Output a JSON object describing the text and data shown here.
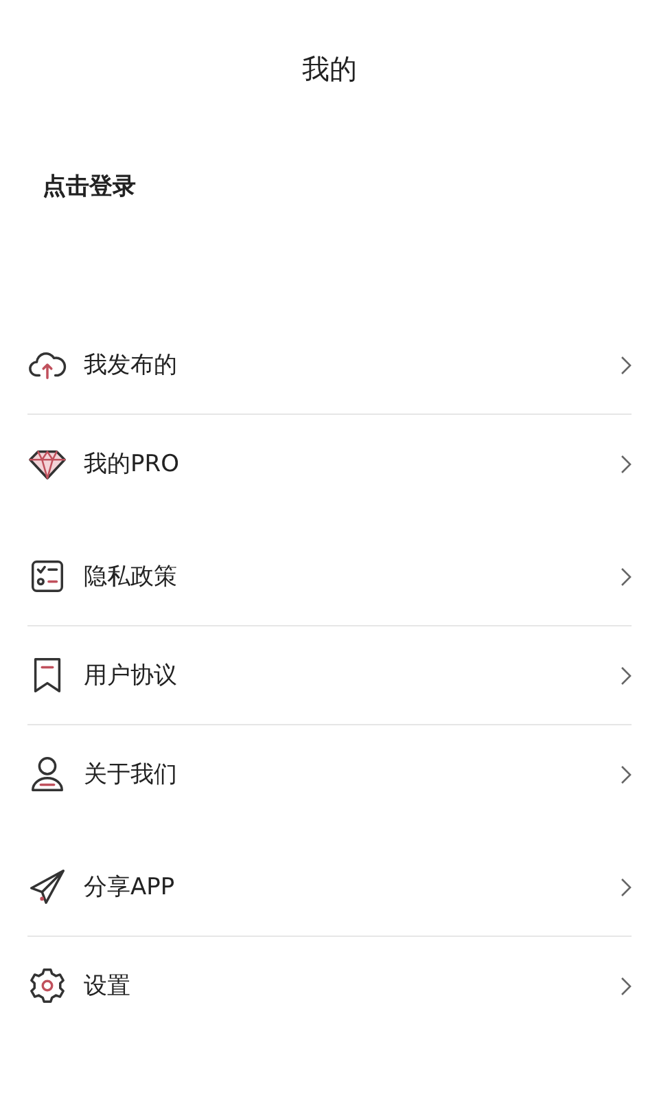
{
  "header": {
    "title": "我的"
  },
  "login": {
    "label": "点击登录"
  },
  "groups": [
    {
      "items": [
        {
          "kind": "cloud",
          "label": "我发布的"
        },
        {
          "kind": "gem",
          "label": "我的PRO"
        }
      ]
    },
    {
      "items": [
        {
          "kind": "checklist",
          "label": "隐私政策"
        },
        {
          "kind": "bookmark",
          "label": "用户协议"
        },
        {
          "kind": "user",
          "label": "关于我们"
        }
      ]
    },
    {
      "items": [
        {
          "kind": "send",
          "label": "分享APP"
        },
        {
          "kind": "gear",
          "label": "设置"
        }
      ]
    }
  ]
}
